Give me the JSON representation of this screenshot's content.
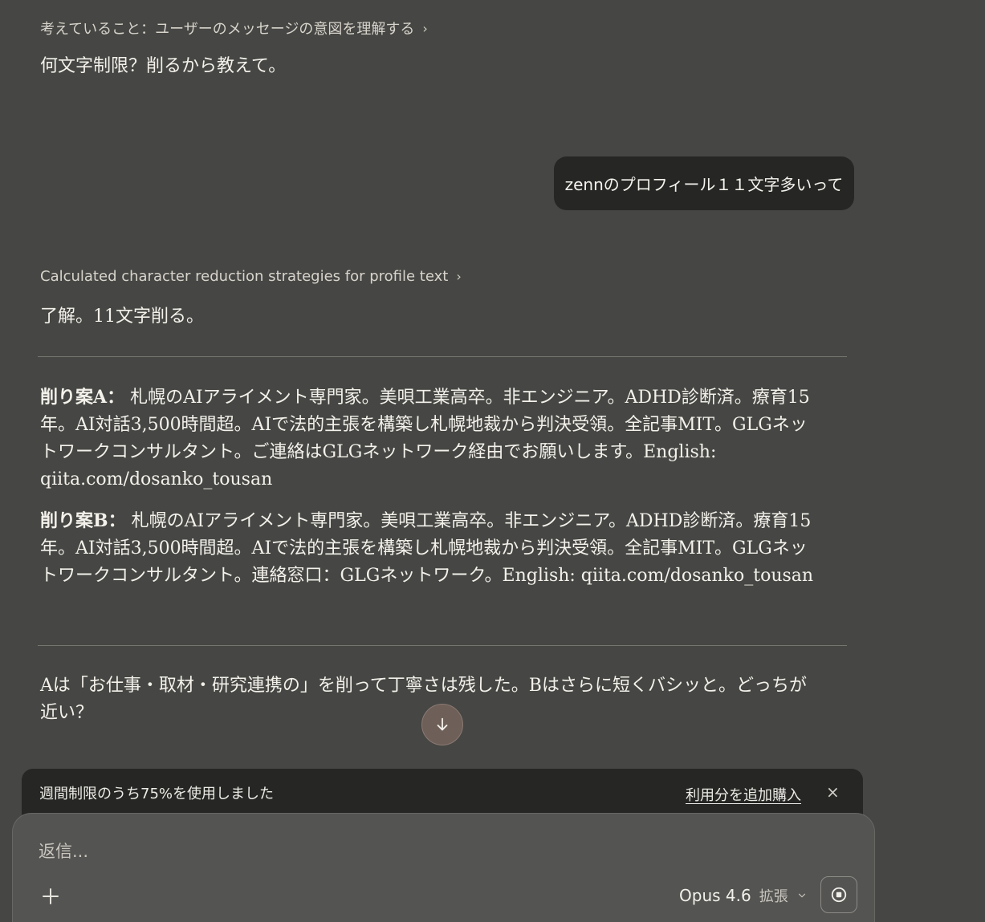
{
  "conversation": {
    "thinking_1": "考えていること：ユーザーのメッセージの意図を理解する",
    "assistant_1": "何文字制限？削るから教えて。",
    "user_1": "zennのプロフィール１１文字多いって",
    "thinking_2": "Calculated character reduction strategies for profile text",
    "assistant_2": "了解。11文字削る。",
    "proposal_a": {
      "label": "削り案A：",
      "text": "札幌のAIアライメント専門家。美唄工業高卒。非エンジニア。ADHD診断済。療育15年。AI対話3,500時間超。AIで法的主張を構築し札幌地裁から判決受領。全記事MIT。GLGネットワークコンサルタント。ご連絡はGLGネットワーク経由でお願いします。English: qiita.com/dosanko_tousan"
    },
    "proposal_b": {
      "label": "削り案B：",
      "text": "札幌のAIアライメント専門家。美唄工業高卒。非エンジニア。ADHD診断済。療育15年。AI対話3,500時間超。AIで法的主張を構築し札幌地裁から判決受領。全記事MIT。GLGネットワークコンサルタント。連絡窓口：GLGネットワーク。English: qiita.com/dosanko_tousan"
    },
    "closing": "Aは「お仕事・取材・研究連携の」を削って丁寧さは残した。Bはさらに短くバシッと。どっちが近い？"
  },
  "limit_banner": {
    "text": "週間制限のうち75%を使用しました",
    "link": "利用分を追加購入",
    "close": "×"
  },
  "composer": {
    "placeholder": "返信...",
    "model": "Opus 4.6",
    "mode": "拡張"
  },
  "icons": {
    "chevron_right": "›",
    "chevron_down": "⌄"
  },
  "colors": {
    "background": "#464644",
    "bubble": "#262624",
    "composer": "#545452",
    "scroll_button": "#6e5f59"
  }
}
